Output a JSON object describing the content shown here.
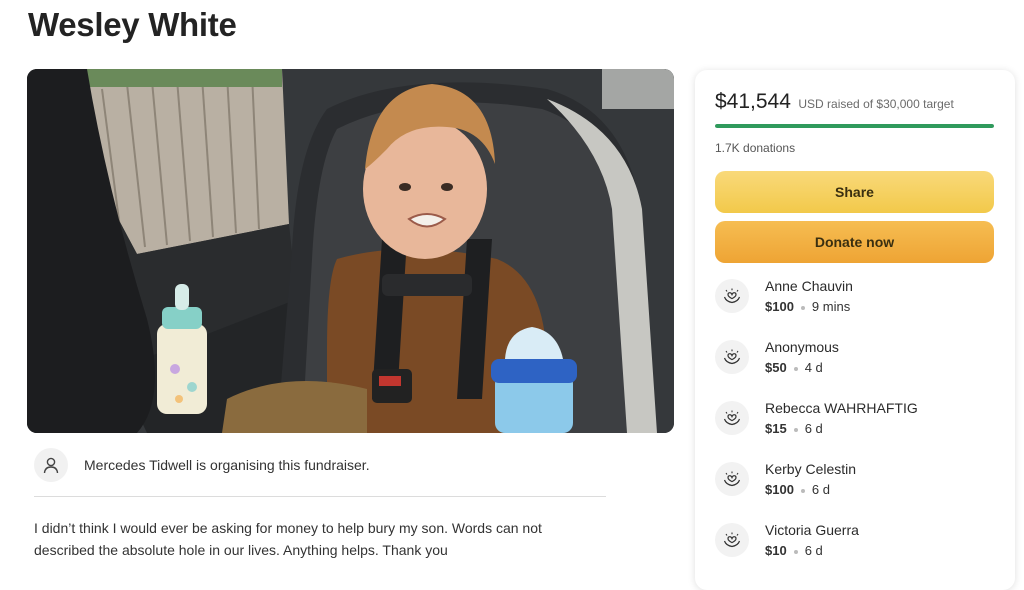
{
  "page": {
    "title": "Wesley White"
  },
  "organiser": {
    "text": "Mercedes Tidwell is organising this fundraiser."
  },
  "story": {
    "text": "I didn’t think I would ever be asking for money to help bury my son. Words can not described the absolute hole in our lives. Anything helps. Thank you"
  },
  "fundraiser": {
    "amount_raised": "$41,544",
    "amount_suffix": "USD raised of $30,000 target",
    "progress_fraction": 1.0,
    "donations_count": "1.7K donations",
    "share_label": "Share",
    "donate_label": "Donate now",
    "accent_color": "#2f9a5c"
  },
  "donors": [
    {
      "name": "Anne Chauvin",
      "amount": "$100",
      "time": "9 mins",
      "icon": "heart-hands-icon"
    },
    {
      "name": "Anonymous",
      "amount": "$50",
      "time": "4 d",
      "icon": "heart-hands-icon"
    },
    {
      "name": "Rebecca WAHRHAFTIG",
      "amount": "$15",
      "time": "6 d",
      "icon": "heart-hands-icon"
    },
    {
      "name": "Kerby Celestin",
      "amount": "$100",
      "time": "6 d",
      "icon": "heart-hands-icon"
    },
    {
      "name": "Victoria Guerra",
      "amount": "$10",
      "time": "6 d",
      "icon": "heart-hands-icon"
    }
  ]
}
